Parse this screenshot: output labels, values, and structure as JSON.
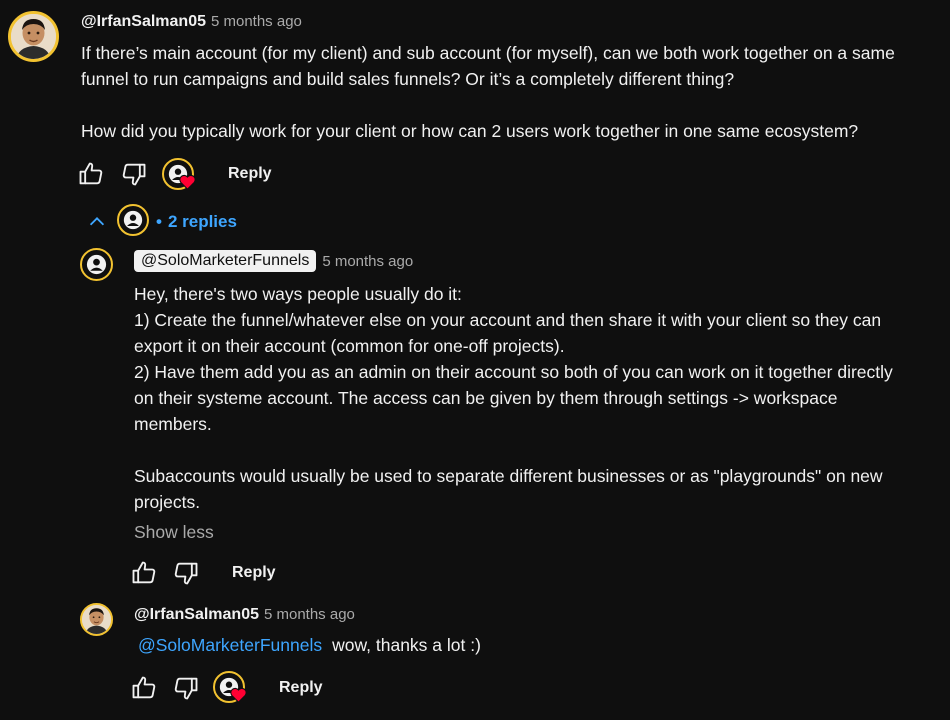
{
  "comment": {
    "author": "@IrfanSalman05",
    "time": "5 months ago",
    "text": "If there’s main account (for my client) and sub account (for myself), can we both work together on a same\nfunnel to run campaigns and build sales funnels? Or it’s a completely different thing?\n\nHow did you typically work for your client or how can 2 users work together in one same ecosystem?",
    "reply_label": "Reply"
  },
  "replies_toggle": {
    "bullet": "•",
    "label": "2 replies"
  },
  "reply1": {
    "author": "@SoloMarketerFunnels",
    "time": "5 months ago",
    "text": "Hey, there's two ways people usually do it:\n1) Create the funnel/whatever else on your account and then share it with your client so they can\nexport it on their account (common for one-off projects).\n2) Have them add you as an admin on their account so both of you can work on it together directly\non their systeme account. The access can be given by them through settings -> workspace\nmembers.\n\nSubaccounts would usually be used to separate different businesses or as \"playgrounds\" on new\nprojects.",
    "show_less": "Show less",
    "reply_label": "Reply"
  },
  "reply2": {
    "author": "@IrfanSalman05",
    "time": "5 months ago",
    "mention": "@SoloMarketerFunnels",
    "text": "wow, thanks a lot :)",
    "reply_label": "Reply"
  },
  "colors": {
    "background": "#0f0f0f",
    "link_blue": "#3ea6ff",
    "creator_ring": "#f2c230",
    "heart_red": "#ff0033"
  },
  "icons": [
    "like-icon",
    "dislike-icon",
    "creator-heart-icon",
    "chevron-up-icon",
    "account-icon"
  ]
}
